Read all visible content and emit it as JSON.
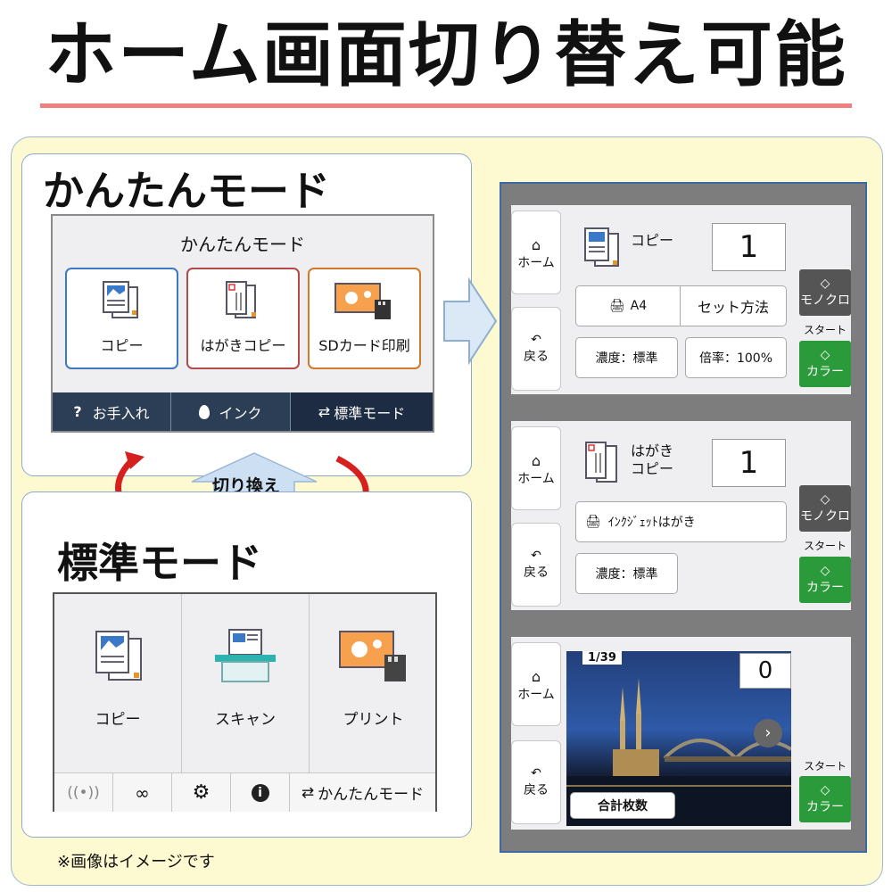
{
  "title": "ホーム画面切り替え可能",
  "simple": {
    "heading": "かんたんモード",
    "screen_title": "かんたんモード",
    "tiles": [
      "コピー",
      "はがきコピー",
      "SDカード印刷"
    ],
    "tile_colors": [
      "#3d79c4",
      "#b24a4a",
      "#d17a2a"
    ],
    "bar": [
      {
        "icon": "question-icon",
        "glyph": "?",
        "label": "お手入れ"
      },
      {
        "icon": "ink-drop-icon",
        "glyph": "💧",
        "label": "インク"
      },
      {
        "icon": "switch-icon",
        "glyph": "⇄",
        "label": "標準モード"
      }
    ]
  },
  "switch_label": "切り換え",
  "standard": {
    "heading": "標準モード",
    "tiles": [
      "コピー",
      "スキャン",
      "プリント"
    ],
    "bar": [
      {
        "icon": "wireless-off-icon",
        "glyph": "📶"
      },
      {
        "icon": "link-icon",
        "glyph": "🔗"
      },
      {
        "icon": "gear-icon",
        "glyph": "⚙"
      },
      {
        "icon": "info-icon",
        "glyph": "ℹ"
      },
      {
        "icon": "switch-icon",
        "glyph": "⇄",
        "label": "かんたんモード"
      }
    ]
  },
  "footnote": "※画像はイメージです",
  "copy_screen": {
    "home": "ホーム",
    "back": "戻る",
    "title": "コピー",
    "count": "1",
    "paper": "A4",
    "set_method": "セット方法",
    "density": "濃度：標準",
    "ratio": "倍率：100%",
    "mono": "モノクロ",
    "start": "スタート",
    "color": "カラー"
  },
  "postcard_screen": {
    "home": "ホーム",
    "back": "戻る",
    "title_line1": "はがき",
    "title_line2": "コピー",
    "count": "1",
    "paper": "ｲﾝｸｼﾞｪｯﾄはがき",
    "density": "濃度：標準",
    "mono": "モノクロ",
    "start": "スタート",
    "color": "カラー"
  },
  "photo_screen": {
    "home": "ホーム",
    "back": "戻る",
    "page": "1/39",
    "count": "0",
    "total": "合計枚数",
    "start": "スタート",
    "color": "カラー"
  },
  "colors": {
    "accent_red": "#f08080",
    "panel_bg": "#fdf9d0",
    "bar_dark": "#2c3e55",
    "start_green": "#2b9a3a"
  }
}
